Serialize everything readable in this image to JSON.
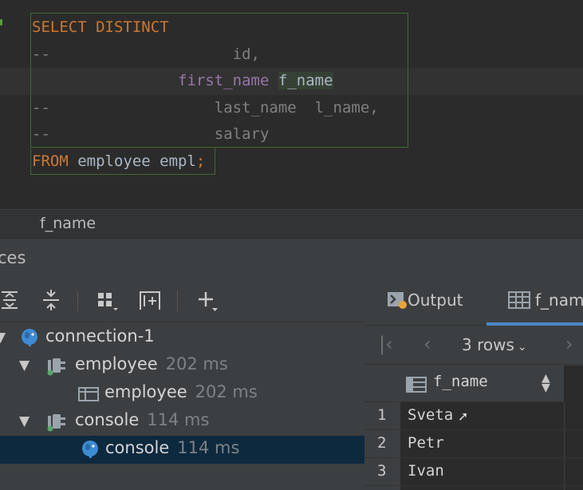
{
  "editor": {
    "lines": [
      {
        "parts": [
          {
            "t": "SELECT DISTINCT",
            "c": "kw"
          }
        ]
      },
      {
        "parts": [
          {
            "t": "--",
            "c": "cm"
          },
          {
            "t": "                    id,",
            "c": "cm"
          }
        ]
      },
      {
        "parts": [
          {
            "t": "                ",
            "c": "id"
          },
          {
            "t": "first_name",
            "c": "fn"
          },
          {
            "t": " ",
            "c": "id"
          },
          {
            "t": "f_name",
            "c": "hl"
          }
        ]
      },
      {
        "parts": [
          {
            "t": "--",
            "c": "cm"
          },
          {
            "t": "                  last_name  l_name,",
            "c": "cm"
          }
        ]
      },
      {
        "parts": [
          {
            "t": "--",
            "c": "cm"
          },
          {
            "t": "                  salary",
            "c": "cm"
          }
        ]
      },
      {
        "parts": [
          {
            "t": "FROM",
            "c": "kw"
          },
          {
            "t": " employee empl",
            "c": "id"
          },
          {
            "t": ";",
            "c": "kw"
          }
        ]
      }
    ]
  },
  "breadcrumb": {
    "text": "f_name"
  },
  "services": {
    "title": "ces"
  },
  "toolbar": {
    "icons": [
      "expand-all-icon",
      "collapse-all-icon",
      "group-by-icon",
      "add-to-group-icon",
      "add-icon"
    ]
  },
  "tree": {
    "connection": {
      "label": "connection-1"
    },
    "session1": {
      "label": "employee",
      "time": "202 ms"
    },
    "table1": {
      "label": "employee",
      "time": "202 ms"
    },
    "session2": {
      "label": "console",
      "time": "114 ms"
    },
    "console": {
      "label": "console",
      "time": "114 ms"
    }
  },
  "results": {
    "tabs": {
      "output": "Output",
      "table": "f_nam"
    },
    "rows_label": "3 rows",
    "column": "f_name",
    "rows": [
      {
        "num": "1",
        "value": "Sveta"
      },
      {
        "num": "2",
        "value": "Petr"
      },
      {
        "num": "3",
        "value": "Ivan"
      }
    ]
  },
  "colors": {
    "editor_bg": "#2b2b2b",
    "panel_bg": "#3c3f41",
    "keyword": "#cc7832",
    "comment": "#808080",
    "field": "#9876aa",
    "selection": "#0d293e",
    "accent": "#4a88c7"
  }
}
